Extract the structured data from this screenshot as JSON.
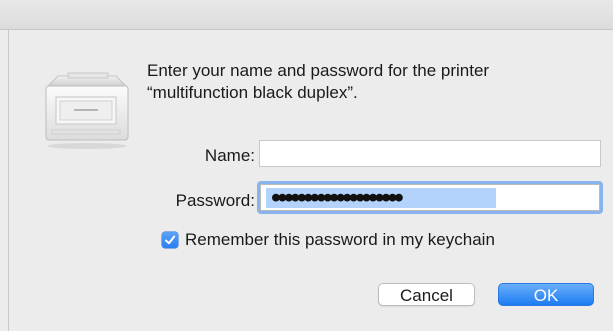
{
  "dialog": {
    "message": "Enter your name and password for the printer “multifunction black duplex”.",
    "name_label": "Name:",
    "name_value": "",
    "password_label": "Password:",
    "password_value": "●●●●●●●●●●●●●●●●●●●●",
    "remember_label": "Remember this password in my keychain",
    "remember_checked": true,
    "cancel_label": "Cancel",
    "ok_label": "OK"
  },
  "icons": {
    "printer": "printer-icon",
    "check": "checkmark-icon"
  },
  "colors": {
    "accent": "#2a7ef3",
    "focus_ring": "#88b3ec",
    "selection": "#b3d3fd",
    "background": "#ececec"
  }
}
